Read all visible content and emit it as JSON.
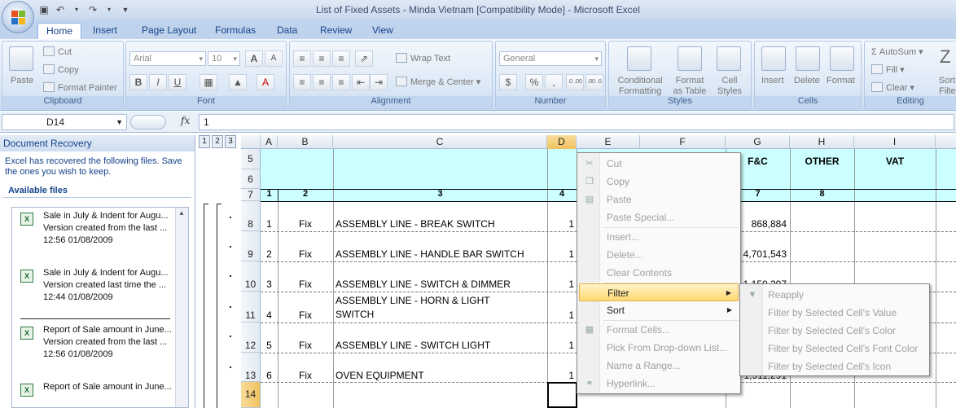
{
  "window": {
    "title": "List of Fixed Assets - Minda Vietnam  [Compatibility Mode] - Microsoft Excel"
  },
  "ribbon_tabs": [
    "Home",
    "Insert",
    "Page Layout",
    "Formulas",
    "Data",
    "Review",
    "View"
  ],
  "ribbon": {
    "clipboard": {
      "paste": "Paste",
      "cut": "Cut",
      "copy": "Copy",
      "format_painter": "Format Painter",
      "label": "Clipboard"
    },
    "font": {
      "name": "Arial",
      "size": "10",
      "bold": "B",
      "italic": "I",
      "underline": "U",
      "grow": "A",
      "shrink": "A",
      "label": "Font"
    },
    "alignment": {
      "wrap": "Wrap Text",
      "merge": "Merge & Center",
      "label": "Alignment"
    },
    "number": {
      "format": "General",
      "currency": "$",
      "percent": "%",
      "comma": ",",
      "inc": ".0 .00",
      "dec": ".00 .0",
      "label": "Number"
    },
    "styles": {
      "conditional": "Conditional",
      "conditional2": "Formatting",
      "format_table": "Format",
      "format_table2": "as Table",
      "cell_styles": "Cell",
      "cell_styles2": "Styles",
      "label": "Styles"
    },
    "cells": {
      "insert": "Insert",
      "delete": "Delete",
      "format": "Format",
      "label": "Cells"
    },
    "editing": {
      "autosum": "AutoSum",
      "fill": "Fill",
      "clear": "Clear",
      "sort": "Sort",
      "sort2": "Filte",
      "label": "Editing"
    }
  },
  "formula_bar": {
    "name_box": "D14",
    "fx": "fx",
    "content": "1"
  },
  "recovery": {
    "header": "Document Recovery",
    "message": "Excel has recovered the following files.  Save the ones you wish to keep.",
    "available": "Available files",
    "files": [
      {
        "name": "Sale in July & Indent for Augu...",
        "desc": "Version created from the last ...",
        "time": "12:56 01/08/2009"
      },
      {
        "name": "Sale in July & Indent for Augu...",
        "desc": "Version created last time the ...",
        "time": "12:44 01/08/2009"
      },
      {
        "name": "Report of Sale amount in June...",
        "desc": "Version created from the last ...",
        "time": "12:56 01/08/2009"
      },
      {
        "name": "Report of Sale amount in June...",
        "desc": "",
        "time": ""
      }
    ]
  },
  "outline_levels": [
    "1",
    "2",
    "3"
  ],
  "columns": [
    "A",
    "B",
    "C",
    "D",
    "E",
    "F",
    "G",
    "H",
    "I"
  ],
  "header_rows": {
    "row5": {
      "G": "F&C",
      "H": "OTHER",
      "I": "VAT"
    },
    "row7": [
      "1",
      "2",
      "3",
      "4",
      "7",
      "8"
    ]
  },
  "rows": [
    {
      "num": "8",
      "A": "1",
      "B": "Fix",
      "C": "ASSEMBLY LINE - BREAK SWITCH",
      "C2": "",
      "D": "1",
      "G": "868,884"
    },
    {
      "num": "9",
      "A": "2",
      "B": "Fix",
      "C": "ASSEMBLY LINE - HANDLE BAR SWITCH",
      "C2": "",
      "D": "1",
      "G": "4,701,543"
    },
    {
      "num": "10",
      "A": "3",
      "B": "Fix",
      "C": "ASSEMBLY LINE - SWITCH & DIMMER",
      "C2": "",
      "D": "1",
      "G": "1,150,307"
    },
    {
      "num": "11",
      "A": "4",
      "B": "Fix",
      "C": "ASSEMBLY LINE - HORN & LIGHT",
      "C2": "SWITCH",
      "D": "1",
      "G": ""
    },
    {
      "num": "12",
      "A": "5",
      "B": "Fix",
      "C": "ASSEMBLY LINE - SWITCH LIGHT",
      "C2": "",
      "D": "1",
      "G": ""
    },
    {
      "num": "13",
      "A": "6",
      "B": "Fix",
      "C": "OVEN EQUIPMENT",
      "C2": "",
      "D": "1",
      "G": "1,911,291"
    }
  ],
  "row_labels": {
    "r5": "5",
    "r6": "6",
    "r7": "7",
    "r14": "14"
  },
  "context_menu": {
    "items": [
      {
        "label": "Cut",
        "icon": "scissors-icon"
      },
      {
        "label": "Copy",
        "icon": "copy-icon"
      },
      {
        "label": "Paste",
        "icon": "paste-icon"
      },
      {
        "label": "Paste Special...",
        "icon": ""
      },
      {
        "label": "Insert...",
        "icon": ""
      },
      {
        "label": "Delete...",
        "icon": ""
      },
      {
        "label": "Clear Contents",
        "icon": ""
      },
      {
        "label": "Filter",
        "icon": ""
      },
      {
        "label": "Sort",
        "icon": ""
      },
      {
        "label": "Format Cells...",
        "icon": "format-cells-icon"
      },
      {
        "label": "Pick From Drop-down List...",
        "icon": ""
      },
      {
        "label": "Name a Range...",
        "icon": ""
      },
      {
        "label": "Hyperlink...",
        "icon": "hyperlink-icon"
      }
    ],
    "submenu": [
      {
        "label": "Reapply",
        "icon": "reapply-filter-icon"
      },
      {
        "label": "Filter by Selected Cell's Value",
        "icon": ""
      },
      {
        "label": "Filter by Selected Cell's Color",
        "icon": ""
      },
      {
        "label": "Filter by Selected Cell's Font Color",
        "icon": ""
      },
      {
        "label": "Filter by Selected Cell's Icon",
        "icon": ""
      }
    ]
  },
  "colors": {
    "header_band": "#ccffff",
    "selected_header": "#f1c15f",
    "menu_hot": "#ffd972",
    "ribbon_blue": "#15428b"
  }
}
